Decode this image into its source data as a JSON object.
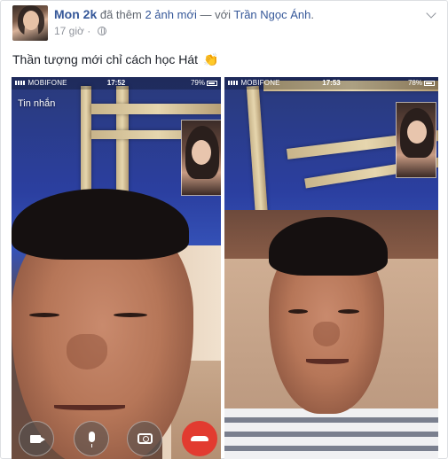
{
  "post": {
    "author": "Mon 2k",
    "action": "đã thêm",
    "photo_count_label": "2 ảnh mới",
    "with_sep": "— với",
    "tagged": "Trần Ngọc Ánh",
    "time": "17 giờ",
    "privacy_icon": "globe-icon",
    "menu_icon": "chevron-down-icon",
    "caption": "Thần tượng mới chỉ cách học Hát",
    "caption_emoji": "👏"
  },
  "photos": [
    {
      "carrier": "MOBIFONE",
      "time": "17:52",
      "battery": "79%",
      "back_label": "Tin nhắn",
      "controls": [
        "video-off-icon",
        "mute-icon",
        "flip-camera-icon",
        "hang-up-icon"
      ]
    },
    {
      "carrier": "MOBIFONE",
      "time": "17:53",
      "battery": "78%"
    }
  ],
  "colors": {
    "link": "#365899",
    "meta": "#90949c",
    "hangup": "#e23b30"
  }
}
